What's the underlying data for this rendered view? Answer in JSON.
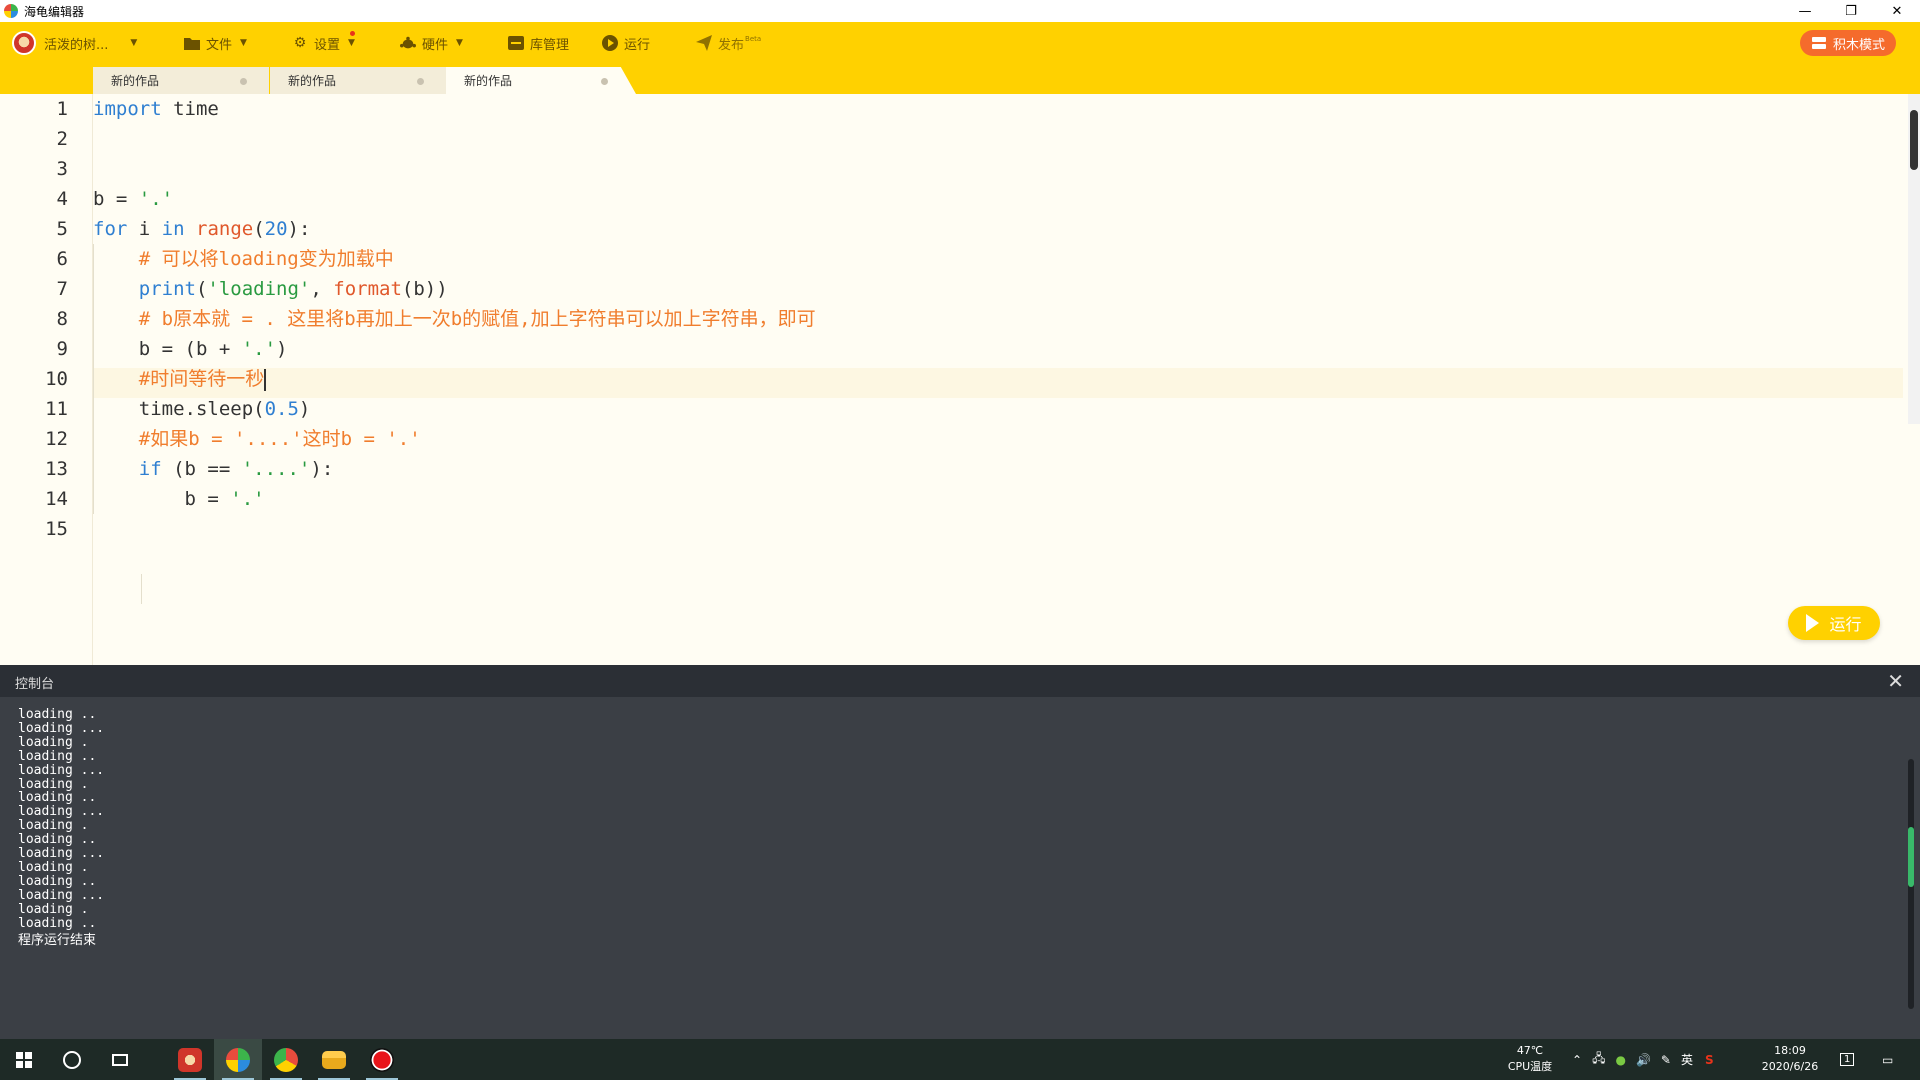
{
  "window": {
    "title": "海龟编辑器",
    "controls": [
      "—",
      "❐",
      "✕"
    ]
  },
  "toolbar": {
    "user": "活泼的树...",
    "file": "文件",
    "settings": "设置",
    "hardware": "硬件",
    "library": "库管理",
    "run": "运行",
    "publish": "发布",
    "publish_badge": "Beta",
    "blocks_mode": "积木模式"
  },
  "tabs": [
    {
      "label": "新的作品",
      "active": false
    },
    {
      "label": "新的作品",
      "active": false
    },
    {
      "label": "新的作品",
      "active": true
    }
  ],
  "editor": {
    "line_numbers": [
      "1",
      "2",
      "3",
      "4",
      "5",
      "6",
      "7",
      "8",
      "9",
      "10",
      "11",
      "12",
      "13",
      "14",
      "15"
    ],
    "current_line": 10,
    "lines": [
      [
        {
          "t": "kw",
          "v": "import"
        },
        {
          "t": "",
          "v": " time"
        }
      ],
      [],
      [],
      [
        {
          "t": "",
          "v": "b = "
        },
        {
          "t": "str",
          "v": "'.'"
        }
      ],
      [
        {
          "t": "kw",
          "v": "for"
        },
        {
          "t": "",
          "v": " i "
        },
        {
          "t": "kw",
          "v": "in"
        },
        {
          "t": "",
          "v": " "
        },
        {
          "t": "fn",
          "v": "range"
        },
        {
          "t": "",
          "v": "("
        },
        {
          "t": "num",
          "v": "20"
        },
        {
          "t": "",
          "v": "):"
        }
      ],
      [
        {
          "t": "",
          "v": "    "
        },
        {
          "t": "cm",
          "v": "# 可以将loading变为加载中"
        }
      ],
      [
        {
          "t": "",
          "v": "    "
        },
        {
          "t": "kw",
          "v": "print"
        },
        {
          "t": "",
          "v": "("
        },
        {
          "t": "str",
          "v": "'loading'"
        },
        {
          "t": "",
          "v": ", "
        },
        {
          "t": "fn",
          "v": "format"
        },
        {
          "t": "",
          "v": "(b))"
        }
      ],
      [
        {
          "t": "",
          "v": "    "
        },
        {
          "t": "cm",
          "v": "# b原本就 = . 这里将b再加上一次b的赋值,加上字符串可以加上字符串，即可"
        }
      ],
      [
        {
          "t": "",
          "v": "    b = (b + "
        },
        {
          "t": "str",
          "v": "'.'"
        },
        {
          "t": "",
          "v": ")"
        }
      ],
      [
        {
          "t": "",
          "v": "    "
        },
        {
          "t": "cm",
          "v": "#时间等待一秒"
        }
      ],
      [
        {
          "t": "",
          "v": "    time.sleep("
        },
        {
          "t": "num",
          "v": "0.5"
        },
        {
          "t": "",
          "v": ")"
        }
      ],
      [
        {
          "t": "",
          "v": "    "
        },
        {
          "t": "cm",
          "v": "#如果b = '....'这时b = '.'"
        }
      ],
      [
        {
          "t": "",
          "v": "    "
        },
        {
          "t": "kw",
          "v": "if"
        },
        {
          "t": "",
          "v": " (b == "
        },
        {
          "t": "str",
          "v": "'....'"
        },
        {
          "t": "",
          "v": "):"
        }
      ],
      [
        {
          "t": "",
          "v": "        b = "
        },
        {
          "t": "str",
          "v": "'.'"
        }
      ],
      []
    ],
    "run_button": "运行"
  },
  "console": {
    "title": "控制台",
    "close": "✕",
    "lines": [
      "loading ..",
      "loading ...",
      "loading .",
      "loading ..",
      "loading ...",
      "loading .",
      "loading ..",
      "loading ...",
      "loading .",
      "loading ..",
      "loading ...",
      "loading .",
      "loading ..",
      "loading ...",
      "loading .",
      "loading ..",
      "程序运行结束"
    ]
  },
  "taskbar": {
    "temp": "47℃",
    "temp_label": "CPU温度",
    "ime": "英",
    "time": "18:09",
    "date": "2020/6/26",
    "notification_count": "1"
  }
}
